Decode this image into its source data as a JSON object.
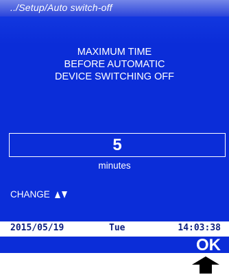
{
  "breadcrumb": "../Setup/Auto switch-off",
  "heading": [
    "MAXIMUM TIME",
    "BEFORE AUTOMATIC",
    "DEVICE SWITCHING OFF"
  ],
  "value": "5",
  "unit": "minutes",
  "change_label": "CHANGE",
  "change_icon": "up-down-arrows-icon",
  "status": {
    "date": "2015/05/19",
    "day": "Tue",
    "time": "14:03:38"
  },
  "ok_label": "OK",
  "colors": {
    "screen_bg": "#0b2dd8",
    "status_text": "#0c1e7e",
    "text": "#ffffff"
  }
}
